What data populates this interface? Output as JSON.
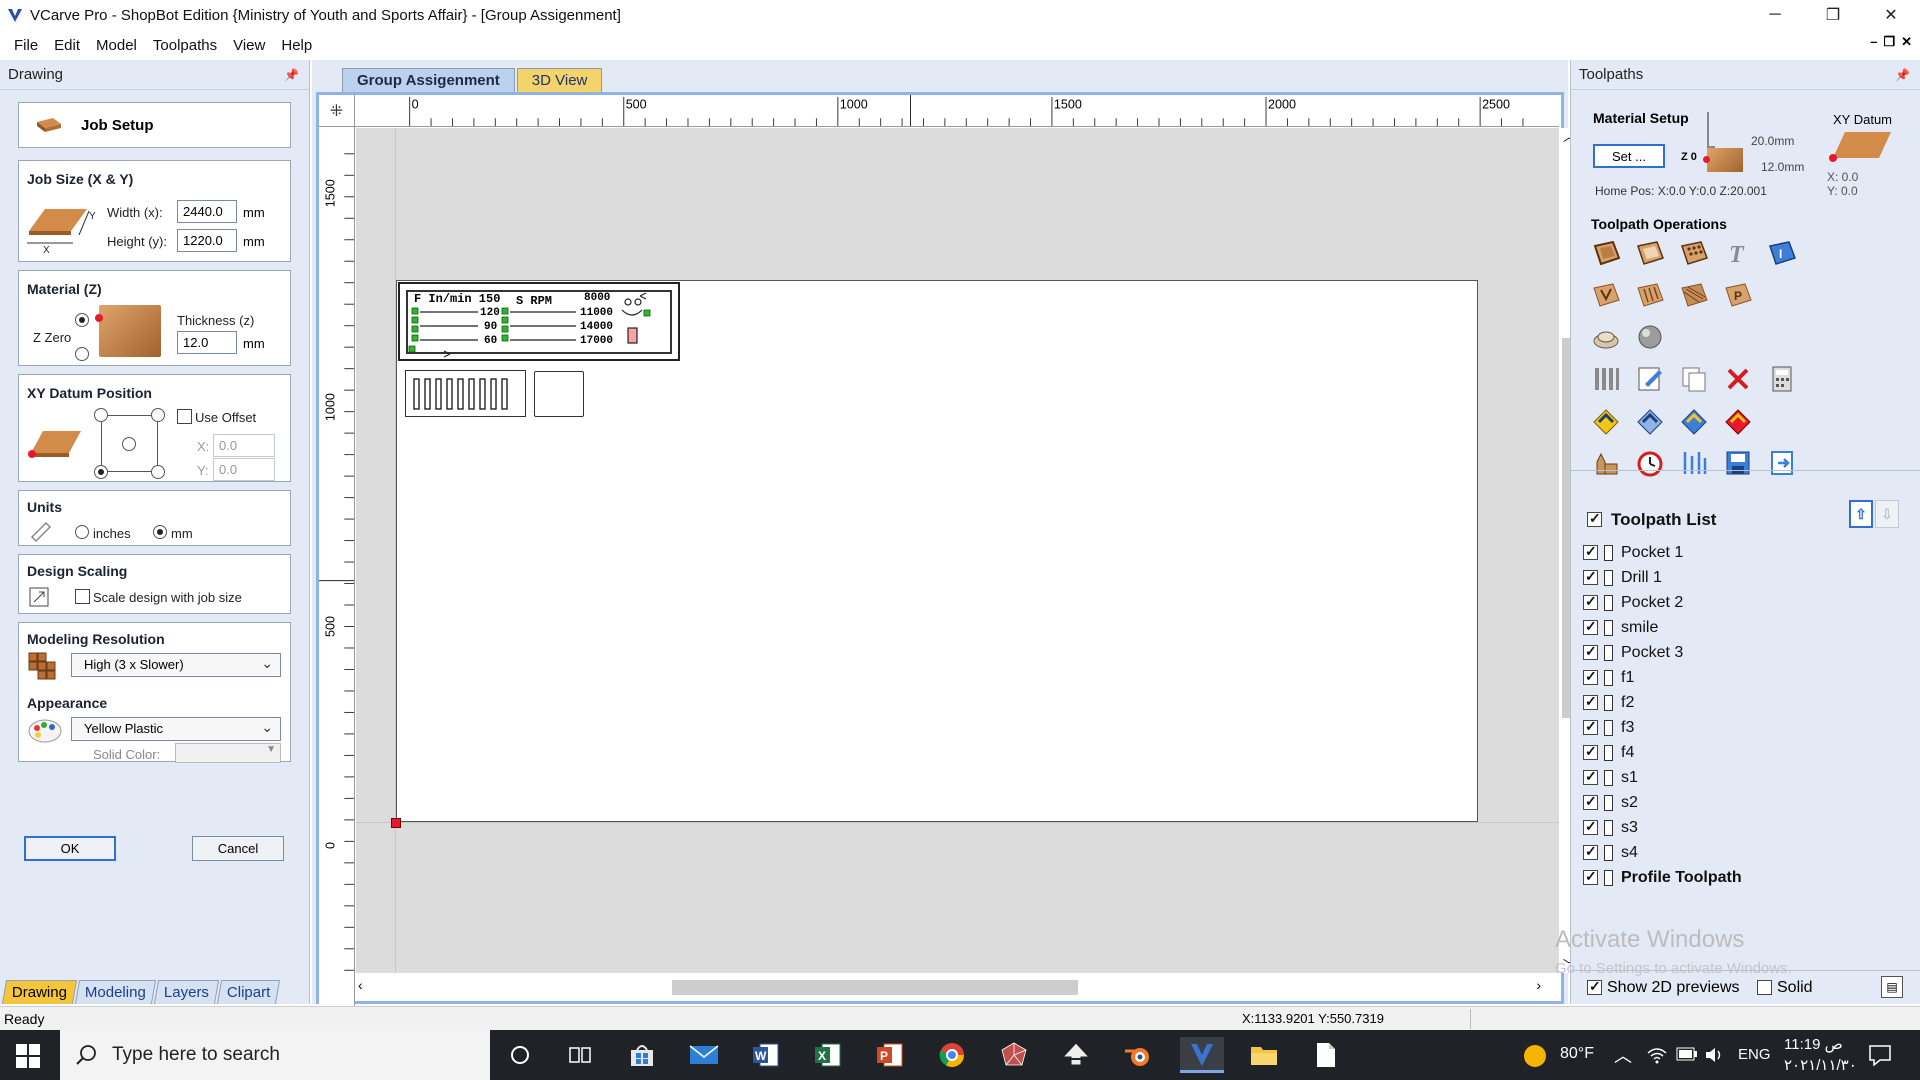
{
  "window": {
    "title": "VCarve Pro - ShopBot Edition {Ministry of Youth and Sports Affair} - [Group Assigenment]",
    "minimize": "─",
    "restore": "❐",
    "close": "✕"
  },
  "menu": [
    "File",
    "Edit",
    "Model",
    "Toolpaths",
    "View",
    "Help"
  ],
  "mdi_buttons": [
    "–",
    "❐",
    "✕"
  ],
  "left_panel": {
    "title": "Drawing",
    "job_setup": "Job Setup",
    "job_size": {
      "title": "Job Size (X & Y)",
      "width_label": "Width (x):",
      "width_value": "2440.0",
      "height_label": "Height (y):",
      "height_value": "1220.0",
      "unit": "mm",
      "axis_y": "Y",
      "axis_x": "X"
    },
    "material": {
      "title": "Material (Z)",
      "thickness_label": "Thickness (z)",
      "thickness_value": "12.0",
      "unit": "mm",
      "zzero_label": "Z Zero"
    },
    "xy_datum": {
      "title": "XY Datum Position",
      "use_offset": "Use Offset",
      "x_label": "X:",
      "x_value": "0.0",
      "y_label": "Y:",
      "y_value": "0.0"
    },
    "units": {
      "title": "Units",
      "inches": "inches",
      "mm": "mm"
    },
    "design_scaling": {
      "title": "Design Scaling",
      "label": "Scale design with job size"
    },
    "modeling_resolution": {
      "title": "Modeling Resolution",
      "value": "High (3 x Slower)"
    },
    "appearance": {
      "title": "Appearance",
      "value": "Yellow Plastic",
      "solid_color_label": "Solid Color:"
    },
    "ok": "OK",
    "cancel": "Cancel",
    "tabs": [
      "Drawing",
      "Modeling",
      "Layers",
      "Clipart"
    ]
  },
  "doc": {
    "tabs": [
      "Group Assigenment",
      "3D View"
    ],
    "ruler_top": [
      "0",
      "500",
      "1000",
      "1500",
      "2000",
      "2500"
    ],
    "ruler_left": [
      "1500",
      "1000",
      "500",
      "0"
    ],
    "sign": {
      "col1_header": "F In/min 150",
      "col1_rows": [
        "120",
        "90",
        "60"
      ],
      "col2_header": "S RPM",
      "col3_header": "8000",
      "col3_rows": [
        "11000",
        "14000",
        "17000"
      ]
    }
  },
  "right_panel": {
    "title": "Toolpaths",
    "material_setup": {
      "title": "Material Setup",
      "set_button": "Set ...",
      "dim1": "20.0mm",
      "dim2": "12.0mm",
      "z0": "Z 0",
      "home_pos": "Home Pos:  X:0.0 Y:0.0 Z:20.001"
    },
    "xy_datum": {
      "title": "XY Datum",
      "x": "X: 0.0",
      "y": "Y: 0.0"
    },
    "toolpath_operations_title": "Toolpath Operations",
    "toolpath_list_title": "Toolpath List",
    "toolpaths": [
      "Pocket 1",
      "Drill 1",
      "Pocket 2",
      "smile",
      "Pocket 3",
      "f1",
      "f2",
      "f3",
      "f4",
      "s1",
      "s2",
      "s3",
      "s4",
      "Profile Toolpath"
    ],
    "show_2d_previews": "Show 2D previews",
    "solid": "Solid",
    "watermark_title": "Activate Windows",
    "watermark_sub": "Go to Settings to activate Windows."
  },
  "status": {
    "left": "Ready",
    "coords": "X:1133.9201 Y:550.7319"
  },
  "taskbar": {
    "search_placeholder": "Type here to search",
    "weather": "80°F",
    "lang": "ENG",
    "time": "11:19 ص",
    "date": "٢٠٢١/١١/٣٠"
  },
  "colors": {
    "accent": "#2f6fd6",
    "tab_active": "#f6c63a",
    "panel_bg": "#e3eaf5",
    "origin_marker": "#e8192c"
  }
}
